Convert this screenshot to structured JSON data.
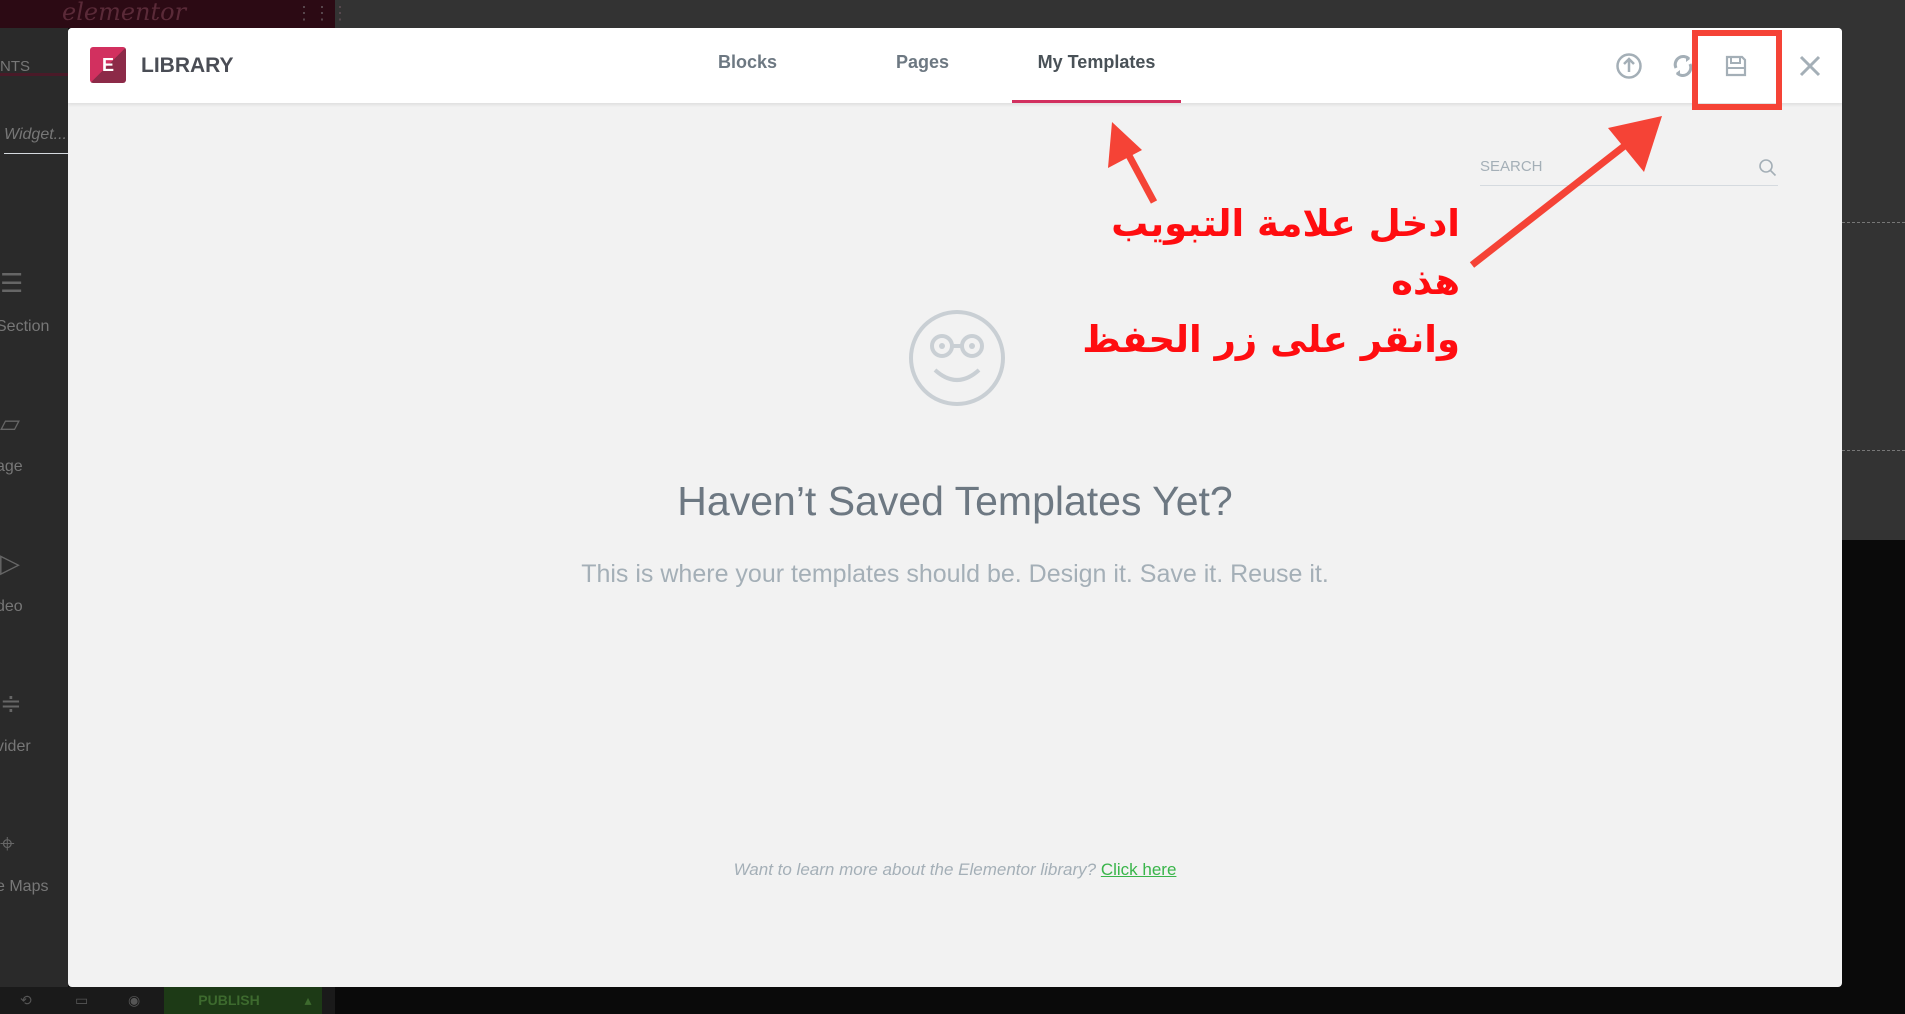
{
  "background": {
    "topbar_logo": "elementor",
    "sidebar": {
      "tab": "ENTS",
      "search_placeholder": "Widget...",
      "items": [
        {
          "label": "Section",
          "icon": "columns-icon"
        },
        {
          "label": "age",
          "icon": "image-icon"
        },
        {
          "label": "deo",
          "icon": "video-icon"
        },
        {
          "label": "vider",
          "icon": "divider-icon"
        },
        {
          "label": "e Maps",
          "icon": "map-icon"
        }
      ]
    },
    "bottombar": {
      "publish": "PUBLISH"
    }
  },
  "modal": {
    "title": "LIBRARY",
    "logo_letter": "E",
    "tabs": [
      {
        "label": "Blocks",
        "active": false
      },
      {
        "label": "Pages",
        "active": false
      },
      {
        "label": "My Templates",
        "active": true
      }
    ],
    "header_icons": [
      "upload-icon",
      "sync-icon",
      "save-icon",
      "close-icon"
    ],
    "search_placeholder": "SEARCH",
    "empty": {
      "icon": "smiley-glasses-icon",
      "title": "Haven’t Saved Templates Yet?",
      "subtitle": "This is where your templates should be. Design it. Save it. Reuse it."
    },
    "footer": {
      "text": "Want to learn more about the Elementor library?",
      "link": "Click here"
    }
  },
  "annotation": {
    "line1": "ادخل علامة التبويب هذه",
    "line2": "وانقر على زر الحفظ",
    "color": "#ff0d10",
    "arrow_color": "#f54336"
  },
  "colors": {
    "accent": "#d2305f",
    "link": "#39b54a"
  }
}
